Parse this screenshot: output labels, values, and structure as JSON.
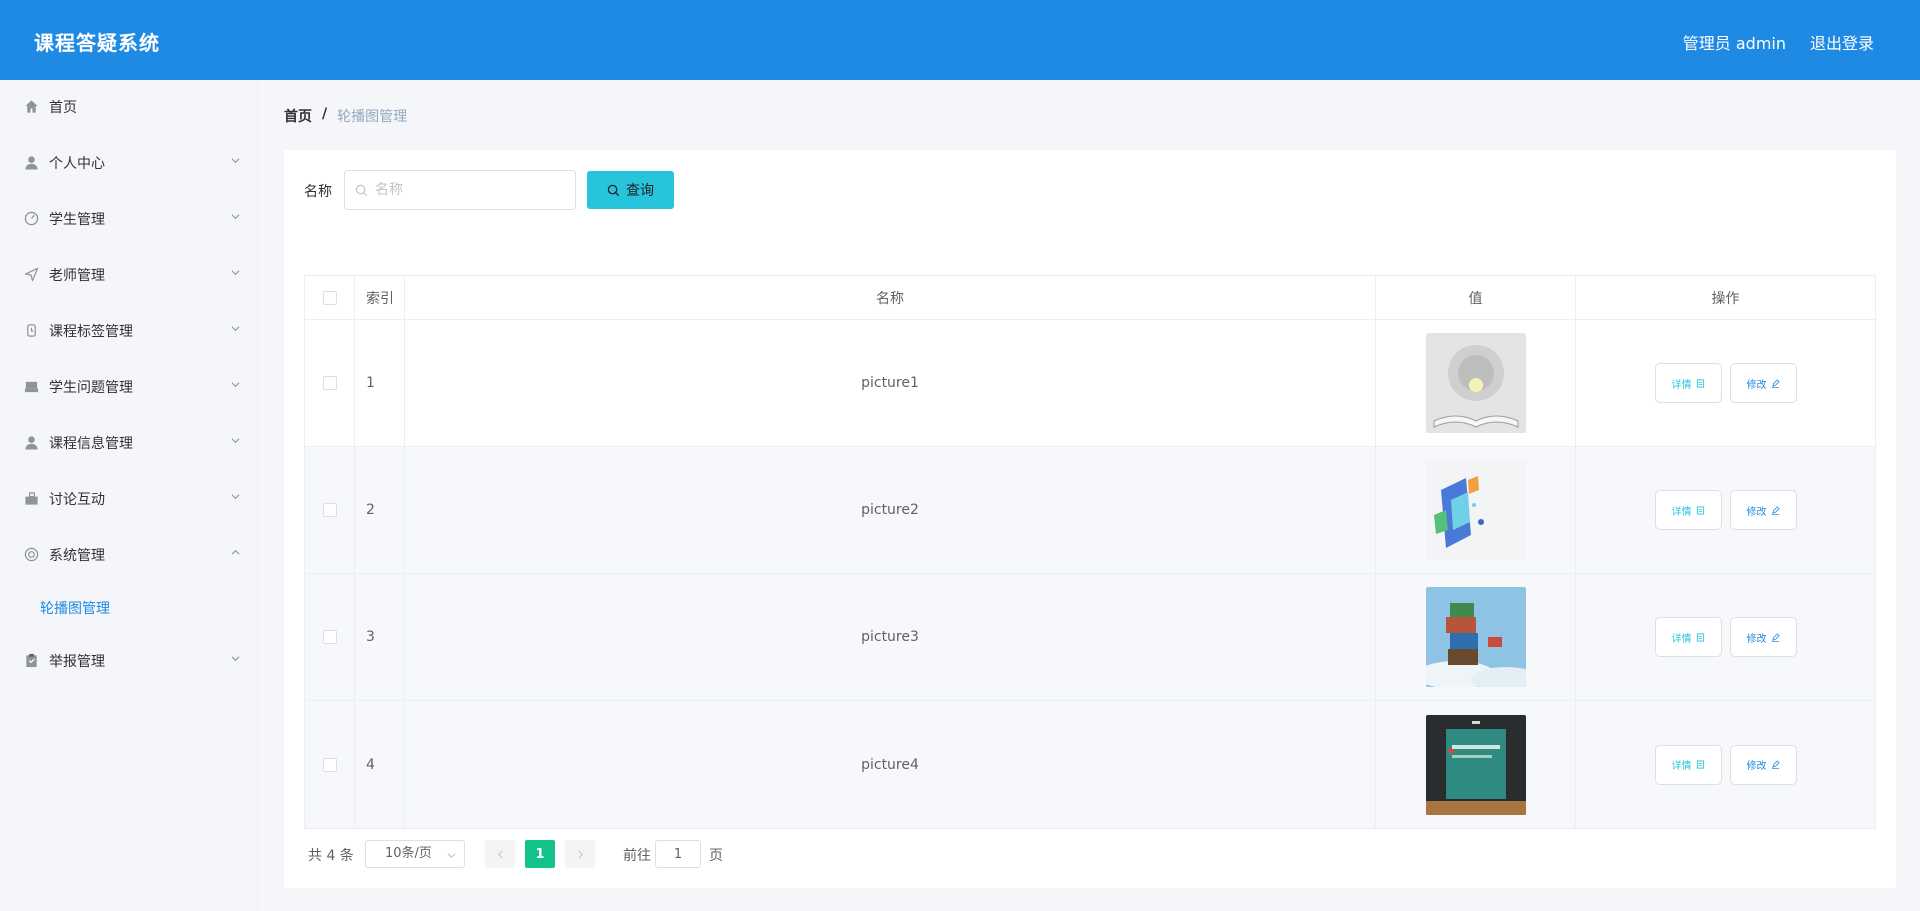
{
  "header": {
    "app_title": "课程答疑系统",
    "admin_label": "管理员 admin",
    "logout_label": "退出登录",
    "bg_color": "#1f8ae3"
  },
  "sidebar": {
    "items": [
      {
        "label": "首页",
        "icon": "home-icon"
      },
      {
        "label": "个人中心",
        "icon": "user-icon"
      },
      {
        "label": "学生管理",
        "icon": "dashboard-icon"
      },
      {
        "label": "老师管理",
        "icon": "paper-plane-icon"
      },
      {
        "label": "课程标签管理",
        "icon": "watch-icon"
      },
      {
        "label": "学生问题管理",
        "icon": "inbox-icon"
      },
      {
        "label": "课程信息管理",
        "icon": "user-icon"
      },
      {
        "label": "讨论互动",
        "icon": "briefcase-icon"
      },
      {
        "label": "系统管理",
        "icon": "lifebuoy-icon"
      },
      {
        "label": "举报管理",
        "icon": "clipboard-icon"
      }
    ],
    "submenu_label": "轮播图管理",
    "active_color": "#1f8ae3"
  },
  "breadcrumb": {
    "home": "首页",
    "separator": "/",
    "current": "轮播图管理"
  },
  "search": {
    "label": "名称",
    "placeholder": "名称",
    "button_label": "查询"
  },
  "table": {
    "headers": {
      "index": "索引",
      "name": "名称",
      "value": "值",
      "actions": "操作"
    },
    "rows": [
      {
        "index": "1",
        "name": "picture1"
      },
      {
        "index": "2",
        "name": "picture2"
      },
      {
        "index": "3",
        "name": "picture3"
      },
      {
        "index": "4",
        "name": "picture4"
      }
    ],
    "detail_label": "详情",
    "edit_label": "修改"
  },
  "pagination": {
    "total": "共 4 条",
    "page_size": "10条/页",
    "current_page": "1",
    "goto_label": "前往",
    "goto_value": "1",
    "page_unit": "页",
    "active_color": "#13c28b"
  }
}
